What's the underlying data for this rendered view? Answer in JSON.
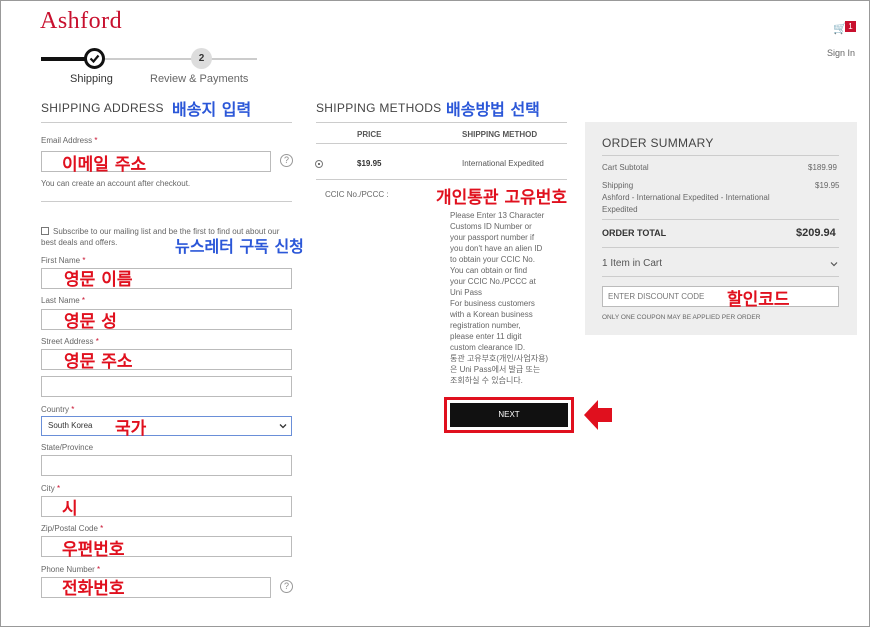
{
  "header": {
    "logo": "Ashford",
    "cart_count": "1",
    "signin": "Sign In"
  },
  "steps": {
    "step1_label": "Shipping",
    "step2_number": "2",
    "step2_label": "Review & Payments"
  },
  "shipping_address": {
    "title": "SHIPPING ADDRESS",
    "annotation": "배송지 입력",
    "email": {
      "label": "Email Address",
      "annotation": "이메일 주소",
      "hint": "You can create an account after checkout."
    },
    "subscribe_text": "Subscribe to our mailing list and be the first to find out about our best deals and offers.",
    "subscribe_annotation": "뉴스레터 구독 신청",
    "first_name": {
      "label": "First Name",
      "annotation": "영문 이름"
    },
    "last_name": {
      "label": "Last Name",
      "annotation": "영문 성"
    },
    "street": {
      "label": "Street Address",
      "annotation": "영문 주소"
    },
    "country": {
      "label": "Country",
      "value": "South Korea",
      "annotation": "국가"
    },
    "state": {
      "label": "State/Province"
    },
    "city": {
      "label": "City",
      "annotation": "시"
    },
    "zip": {
      "label": "Zip/Postal Code",
      "annotation": "우편번호"
    },
    "phone": {
      "label": "Phone Number",
      "annotation": "전화번호"
    },
    "required_mark": "*",
    "help_mark": "?"
  },
  "shipping_methods": {
    "title": "SHIPPING METHODS",
    "annotation": "배송방법 선택",
    "col_price": "PRICE",
    "col_method": "SHIPPING METHOD",
    "price": "$19.95",
    "method": "International Expedited",
    "ccic_label": "CCIC No./PCCC :",
    "ccic_annotation": "개인통관 고유번호",
    "ccic_help": [
      "Please Enter 13 Character",
      "Customs ID Number or",
      "your passport number if",
      "you don't have an alien ID",
      "to obtain your CCIC No.",
      "You can obtain or find",
      "your CCIC No./PCCC at",
      "Uni Pass",
      "For business customers",
      "with a Korean business",
      "registration number,",
      "please enter 11 digit",
      "custom clearance ID.",
      "통관 고유부호(개인/사업자용)",
      "은 Uni Pass에서 발급 또는",
      "조회하실 수 있습니다."
    ],
    "next_button": "NEXT"
  },
  "order_summary": {
    "title": "ORDER SUMMARY",
    "subtotal_label": "Cart Subtotal",
    "subtotal_value": "$189.99",
    "shipping_label": "Shipping",
    "shipping_value": "$19.95",
    "shipping_detail": "Ashford - International Expedited - International Expedited",
    "total_label": "ORDER TOTAL",
    "total_value": "$209.94",
    "items_in_cart": "1 Item in Cart",
    "discount_placeholder": "ENTER DISCOUNT CODE",
    "discount_annotation": "할인코드",
    "coupon_note": "ONLY ONE COUPON MAY BE APPLIED PER ORDER"
  },
  "colors": {
    "brand": "#c8102e",
    "annotation_red": "#e0101e",
    "annotation_blue": "#2b57d8"
  }
}
